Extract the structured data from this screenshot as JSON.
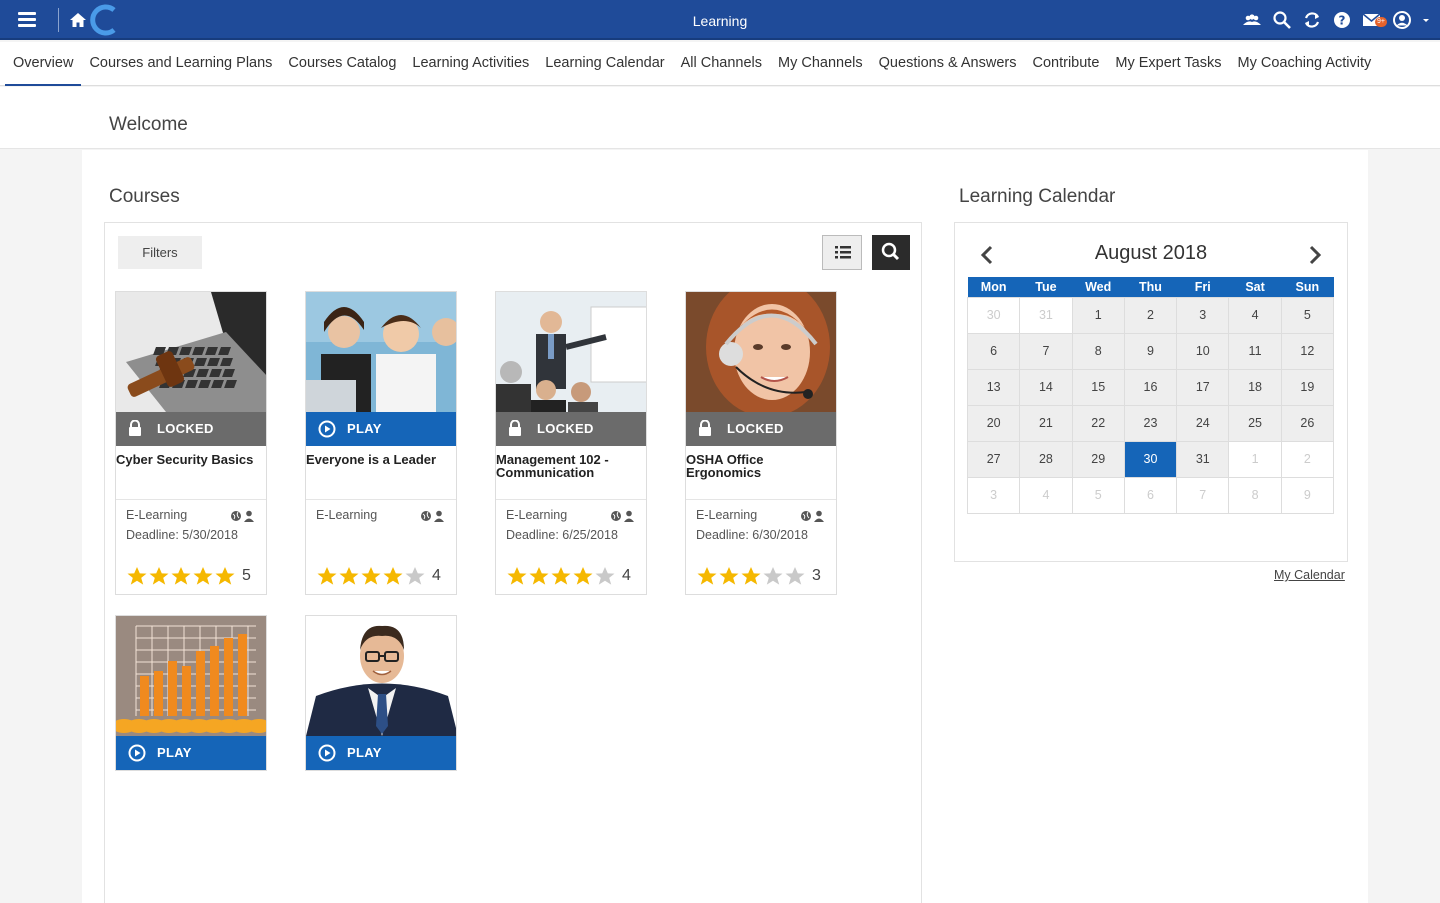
{
  "app": {
    "title": "Learning",
    "badge_count": "9+"
  },
  "colors": {
    "topbar": "#1f4b99",
    "accent": "#1565b8",
    "locked": "#6b6b6b",
    "star": "#f5b800"
  },
  "nav": {
    "tabs": [
      {
        "label": "Overview",
        "active": true
      },
      {
        "label": "Courses and Learning Plans"
      },
      {
        "label": "Courses Catalog"
      },
      {
        "label": "Learning Activities"
      },
      {
        "label": "Learning Calendar"
      },
      {
        "label": "All Channels"
      },
      {
        "label": "My Channels"
      },
      {
        "label": "Questions & Answers"
      },
      {
        "label": "Contribute"
      },
      {
        "label": "My Expert Tasks"
      },
      {
        "label": "My Coaching Activity"
      }
    ]
  },
  "welcome": {
    "title": "Welcome"
  },
  "courses": {
    "title": "Courses",
    "filters_label": "Filters",
    "items": [
      {
        "status": "LOCKED",
        "name": "Cyber Security Basics",
        "type": "E-Learning",
        "deadline": "Deadline: 5/30/2018",
        "rating": 5,
        "rating_label": "5",
        "image": "laptop-gavel"
      },
      {
        "status": "PLAY",
        "name": "Everyone is a Leader",
        "type": "E-Learning",
        "deadline": "",
        "rating": 4,
        "rating_label": "4",
        "image": "business-team"
      },
      {
        "status": "LOCKED",
        "name": "Management 102 - Communication",
        "type": "E-Learning",
        "deadline": "Deadline: 6/25/2018",
        "rating": 4,
        "rating_label": "4",
        "image": "presentation"
      },
      {
        "status": "LOCKED",
        "name": "OSHA Office Ergonomics",
        "type": "E-Learning",
        "deadline": "Deadline: 6/30/2018",
        "rating": 3,
        "rating_label": "3",
        "image": "headset-woman"
      },
      {
        "status": "PLAY",
        "image": "bar-chart-coins"
      },
      {
        "status": "PLAY",
        "image": "businessman"
      }
    ]
  },
  "calendar": {
    "title": "Learning Calendar",
    "month": "August 2018",
    "weekdays": [
      "Mon",
      "Tue",
      "Wed",
      "Thu",
      "Fri",
      "Sat",
      "Sun"
    ],
    "weeks": [
      [
        {
          "d": "30",
          "o": true
        },
        {
          "d": "31",
          "o": true
        },
        {
          "d": "1"
        },
        {
          "d": "2"
        },
        {
          "d": "3"
        },
        {
          "d": "4"
        },
        {
          "d": "5"
        }
      ],
      [
        {
          "d": "6"
        },
        {
          "d": "7"
        },
        {
          "d": "8"
        },
        {
          "d": "9"
        },
        {
          "d": "10"
        },
        {
          "d": "11"
        },
        {
          "d": "12"
        }
      ],
      [
        {
          "d": "13"
        },
        {
          "d": "14"
        },
        {
          "d": "15"
        },
        {
          "d": "16"
        },
        {
          "d": "17"
        },
        {
          "d": "18"
        },
        {
          "d": "19"
        }
      ],
      [
        {
          "d": "20"
        },
        {
          "d": "21"
        },
        {
          "d": "22"
        },
        {
          "d": "23"
        },
        {
          "d": "24"
        },
        {
          "d": "25"
        },
        {
          "d": "26"
        }
      ],
      [
        {
          "d": "27"
        },
        {
          "d": "28"
        },
        {
          "d": "29"
        },
        {
          "d": "30",
          "t": true
        },
        {
          "d": "31"
        },
        {
          "d": "1",
          "o": true
        },
        {
          "d": "2",
          "o": true
        }
      ],
      [
        {
          "d": "3",
          "o": true
        },
        {
          "d": "4",
          "o": true
        },
        {
          "d": "5",
          "o": true
        },
        {
          "d": "6",
          "o": true
        },
        {
          "d": "7",
          "o": true
        },
        {
          "d": "8",
          "o": true
        },
        {
          "d": "9",
          "o": true
        }
      ]
    ],
    "link": "My Calendar"
  }
}
